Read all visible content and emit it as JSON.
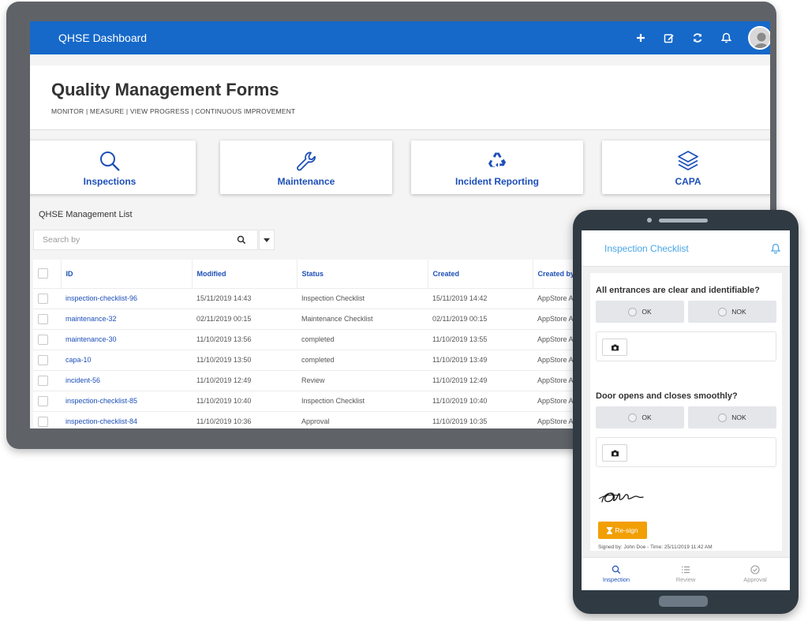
{
  "topbar": {
    "title": "QHSE Dashboard",
    "actions": [
      "plus-icon",
      "edit-icon",
      "refresh-icon",
      "bell-icon",
      "avatar"
    ]
  },
  "header": {
    "title": "Quality Management Forms",
    "subtitle": "MONITOR | MEASURE | VIEW PROGRESS | CONTINUOUS IMPROVEMENT"
  },
  "tiles": [
    {
      "label": "Inspections",
      "icon": "search-icon"
    },
    {
      "label": "Maintenance",
      "icon": "wrench-icon"
    },
    {
      "label": "Incident Reporting",
      "icon": "recycle-icon"
    },
    {
      "label": "CAPA",
      "icon": "layers-icon"
    }
  ],
  "list": {
    "title": "QHSE Management List",
    "search_placeholder": "Search by",
    "columns": [
      "ID",
      "Modified",
      "Status",
      "Created",
      "Created by"
    ],
    "rows": [
      {
        "id": "inspection-checklist-96",
        "modified": "15/11/2019 14:43",
        "status": "Inspection Checklist",
        "created": "15/11/2019 14:42",
        "created_by": "AppStore Adm"
      },
      {
        "id": "maintenance-32",
        "modified": "02/11/2019 00:15",
        "status": "Maintenance Checklist",
        "created": "02/11/2019 00:15",
        "created_by": "AppStore Adm"
      },
      {
        "id": "maintenance-30",
        "modified": "11/10/2019 13:56",
        "status": "completed",
        "created": "11/10/2019 13:55",
        "created_by": "AppStore Adm"
      },
      {
        "id": "capa-10",
        "modified": "11/10/2019 13:50",
        "status": "completed",
        "created": "11/10/2019 13:49",
        "created_by": "AppStore Adm"
      },
      {
        "id": "incident-56",
        "modified": "11/10/2019 12:49",
        "status": "Review",
        "created": "11/10/2019 12:49",
        "created_by": "AppStore Adm"
      },
      {
        "id": "inspection-checklist-85",
        "modified": "11/10/2019 10:40",
        "status": "Inspection Checklist",
        "created": "11/10/2019 10:40",
        "created_by": "AppStore Adm"
      },
      {
        "id": "inspection-checklist-84",
        "modified": "11/10/2019 10:36",
        "status": "Approval",
        "created": "11/10/2019 10:35",
        "created_by": "AppStore Adm"
      }
    ]
  },
  "phone": {
    "title": "Inspection Checklist",
    "questions": [
      {
        "text": "All entrances are clear and identifiable?",
        "options": [
          "OK",
          "NOK"
        ]
      },
      {
        "text": "Door opens and closes smoothly?",
        "options": [
          "OK",
          "NOK"
        ]
      }
    ],
    "resign_label": "Re-sign",
    "signed_text": "Signed by: John Doe - Time: 25/11/2019 11:42 AM",
    "nav": [
      {
        "label": "Inspection",
        "icon": "search-icon",
        "active": true
      },
      {
        "label": "Review",
        "icon": "list-icon",
        "active": false
      },
      {
        "label": "Approval",
        "icon": "check-circle-icon",
        "active": false
      }
    ]
  },
  "colors": {
    "primary": "#1669c9",
    "link": "#1d4fb8",
    "accent": "#f29f05",
    "phone_title": "#4aa6e6"
  }
}
